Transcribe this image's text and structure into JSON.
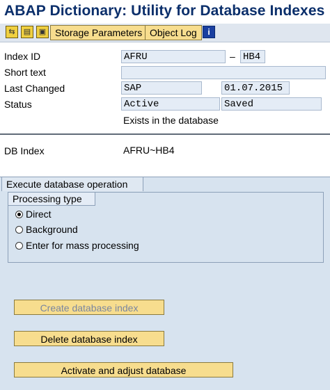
{
  "window": {
    "title": "ABAP Dictionary: Utility for Database Indexes"
  },
  "toolbar": {
    "icons": [
      "choose-icon",
      "document-icon",
      "print-icon"
    ],
    "storage_parameters": "Storage Parameters",
    "object_log": "Object Log",
    "info_icon": "i"
  },
  "form": {
    "index_id_label": "Index ID",
    "index_id_table": "AFRU",
    "index_id_sep": "–",
    "index_id_name": "HB4",
    "short_text_label": "Short text",
    "short_text_value": "",
    "last_changed_label": "Last Changed",
    "last_changed_user": "SAP",
    "last_changed_date": "01.07.2015",
    "status_label": "Status",
    "status_value": "Active",
    "status_saved": "Saved",
    "status_note": "Exists in the database",
    "db_index_label": "DB Index",
    "db_index_value": "AFRU~HB4"
  },
  "execute": {
    "tab_label": "Execute database operation",
    "processing_type_label": "Processing type",
    "options": [
      {
        "label": "Direct",
        "selected": true
      },
      {
        "label": "Background",
        "selected": false
      },
      {
        "label": "Enter for mass processing",
        "selected": false
      }
    ],
    "create_button": "Create database index",
    "delete_button": "Delete database index",
    "activate_button": "Activate and adjust database"
  },
  "colors": {
    "title_text": "#0b2f6b",
    "button_bg": "#f7dd8e",
    "field_bg": "#e4ecf6",
    "panel_bg": "#d7e3ef"
  }
}
